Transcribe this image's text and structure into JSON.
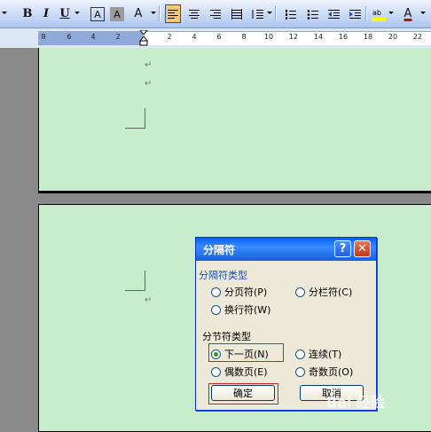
{
  "toolbar": {
    "bold": "B",
    "italic": "I",
    "underline": "U",
    "char_border": "A",
    "char_shading": "A",
    "text_effect": "A",
    "font_color": "A"
  },
  "ruler": {
    "left_numbers": [
      "8",
      "6",
      "4",
      "2"
    ],
    "right_numbers": [
      "2",
      "4",
      "6",
      "8",
      "10",
      "12",
      "14",
      "16",
      "18",
      "20",
      "22"
    ]
  },
  "document": {
    "paragraph_mark": "↵"
  },
  "dialog": {
    "title": "分隔符",
    "help_label": "?",
    "close_label": "✕",
    "group_break_types": "分隔符类型",
    "page_break": "分页符(P)",
    "column_break": "分栏符(C)",
    "text_wrap_break": "换行符(W)",
    "group_section_types": "分节符类型",
    "next_page": "下一页(N)",
    "continuous": "连续(T)",
    "even_page": "偶数页(E)",
    "odd_page": "奇数页(O)",
    "ok_label": "确定",
    "cancel_label": "取消"
  },
  "watermark": "Bai 经验",
  "colors": {
    "page": "#c7edcc",
    "highlight_red": "#d42020",
    "title_blue": "#0a5fee"
  }
}
